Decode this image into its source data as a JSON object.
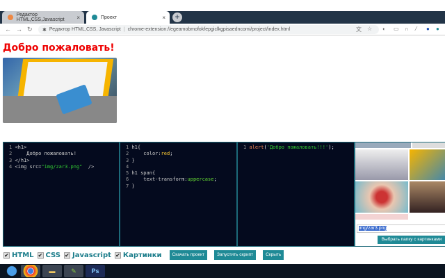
{
  "browser": {
    "tabs": [
      {
        "title": "Редактор HTML,CSS,Javascript",
        "close": "×"
      },
      {
        "title": "Проект",
        "close": "×"
      }
    ],
    "new_tab": "+",
    "address": {
      "site": "Редактор HTML,CSS, Javascript",
      "url": "chrome-extension://egeamobmofokfepgiclkgpisaedncomi/project/index.html"
    }
  },
  "page": {
    "heading": "Добро пожаловать!"
  },
  "editor": {
    "html": [
      {
        "n": "1",
        "code": "<h1>"
      },
      {
        "n": "2",
        "code": "    Добро пожаловать!"
      },
      {
        "n": "3",
        "code": "</h1>"
      },
      {
        "n": "4",
        "code": "<img src=",
        "str": "\"img/zar3.png\"",
        "end": "  />"
      }
    ],
    "css": [
      {
        "n": "1",
        "code": "h1{"
      },
      {
        "n": "2",
        "code": "    color:",
        "val": "red",
        ";": ";"
      },
      {
        "n": "3",
        "code": "}"
      },
      {
        "n": "4",
        "code": ""
      },
      {
        "n": "5",
        "code": "h1 span{"
      },
      {
        "n": "6",
        "code": "    text-transform:",
        "val": "uppercase",
        ";": ";"
      },
      {
        "n": "7",
        "code": "}"
      }
    ],
    "js": [
      {
        "n": "1",
        "fn": "alert",
        "str": "'Добро пожаловать!!!'",
        "end": ");"
      }
    ],
    "image_path": "img/zar3.png",
    "folder_button": "Выбрать папку с картинками"
  },
  "controls": {
    "checkboxes": [
      {
        "label": "HTML",
        "checked": true
      },
      {
        "label": "CSS",
        "checked": true
      },
      {
        "label": "Javascript",
        "checked": true
      },
      {
        "label": "Картинки",
        "checked": true
      }
    ],
    "download": "Скачать проект",
    "run": "Запустить скрипт",
    "hide": "Скрыть"
  },
  "colors": {
    "accent": "#1f8a96",
    "heading": "#ee0000",
    "editor_bg": "#040a1e"
  }
}
